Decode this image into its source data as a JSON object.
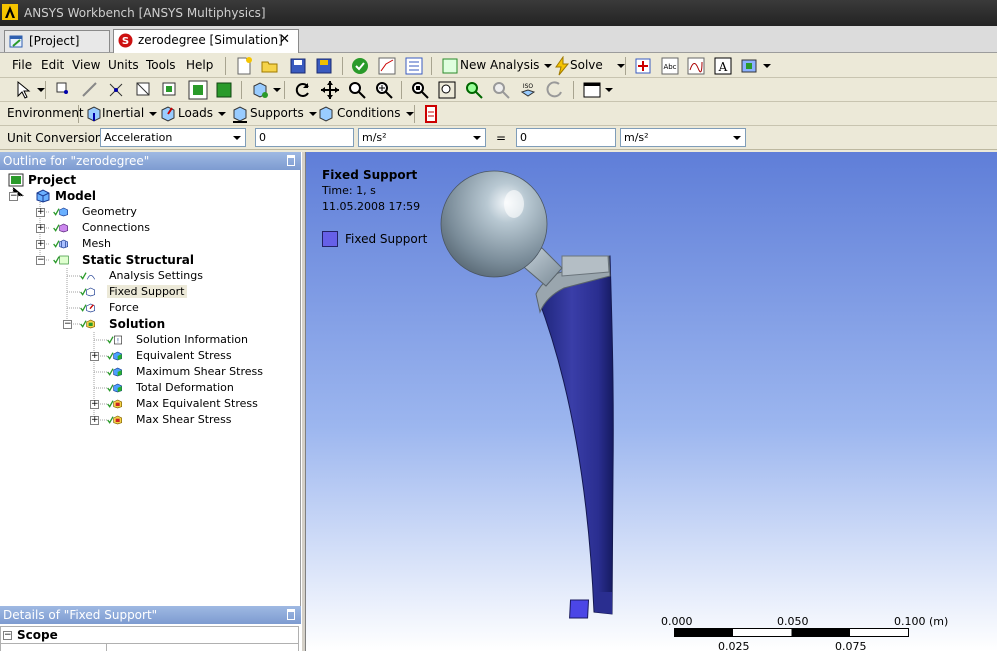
{
  "window": {
    "title": "ANSYS Workbench [ANSYS Multiphysics]"
  },
  "tabs": [
    {
      "label": "[Project]"
    },
    {
      "label": "zerodegree [Simulation]",
      "close": "✕"
    }
  ],
  "menu": [
    "File",
    "Edit",
    "View",
    "Units",
    "Tools",
    "Help"
  ],
  "toolbar": {
    "new_analysis": "New Analysis",
    "solve": "Solve"
  },
  "context_toolbar": {
    "environment": "Environment",
    "inertial": "Inertial",
    "loads": "Loads",
    "supports": "Supports",
    "conditions": "Conditions"
  },
  "unit_conversion": {
    "label": "Unit Conversion",
    "quantity": "Acceleration",
    "value_in": "0",
    "unit_in": "m/s²",
    "equals": "=",
    "value_out": "0",
    "unit_out": "m/s²"
  },
  "outline": {
    "header": "Outline for \"zerodegree\"",
    "tree": [
      "Project",
      "Model",
      "Geometry",
      "Connections",
      "Mesh",
      "Static Structural",
      "Analysis Settings",
      "Fixed Support",
      "Force",
      "Solution",
      "Solution Information",
      "Equivalent Stress",
      "Maximum Shear Stress",
      "Total Deformation",
      "Max Equivalent Stress",
      "Max Shear Stress"
    ]
  },
  "details": {
    "header": "Details of \"Fixed Support\"",
    "section": "Scope"
  },
  "viewport": {
    "title": "Fixed Support",
    "time": "Time: 1, s",
    "date": "11.05.2008 17:59",
    "legend_label": "Fixed Support",
    "legend_color": "#6660e8",
    "scale": {
      "top": [
        "0.000",
        "0.050",
        "0.100 (m)"
      ],
      "bottom": [
        "0.025",
        "0.075"
      ]
    }
  }
}
